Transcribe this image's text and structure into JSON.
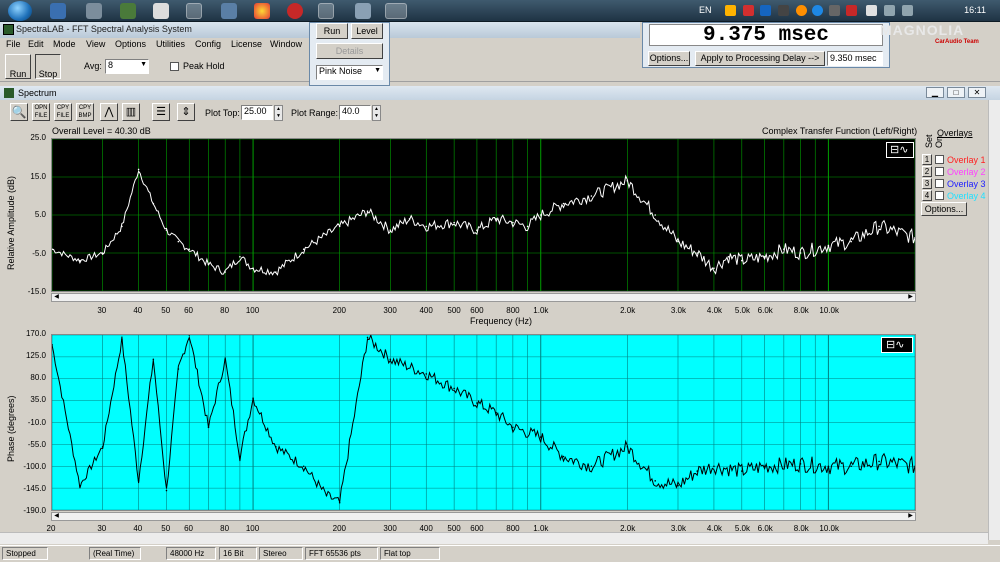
{
  "taskbar": {
    "language": "EN",
    "clock": "16:11",
    "watermark": "MAGNOLIA",
    "watermark_sub": "CarAudio Team"
  },
  "app": {
    "title": "SpectraLAB - FFT Spectral Analysis System",
    "menus": [
      "File",
      "Edit",
      "Mode",
      "View",
      "Options",
      "Utilities",
      "Config",
      "License",
      "Window"
    ],
    "run_label": "Run",
    "stop_label": "Stop",
    "avg_label": "Avg:",
    "avg_value": "8",
    "peak_hold_label": "Peak Hold"
  },
  "generator_popup": {
    "run_label": "Run",
    "level_label": "Level",
    "details_label": "Details",
    "signal_value": "Pink Noise"
  },
  "delay": {
    "value": "9.375 msec",
    "options_label": "Options...",
    "apply_label": "Apply to Processing Delay -->",
    "applied_value": "9.350 msec"
  },
  "spectrum": {
    "window_title": "Spectrum",
    "plot_top_label": "Plot Top:",
    "plot_top_value": "25.00",
    "plot_range_label": "Plot Range:",
    "plot_range_value": "40.0",
    "overall_level": "Overall Level = 40.30 dB",
    "mode_caption": "Complex Transfer Function (Left/Right)",
    "amp_ylabel": "Relative Amplitude (dB)",
    "phase_ylabel": "Phase (degrees)",
    "xlabel": "Frequency (Hz)",
    "amp_yticks": [
      "25.0",
      "15.0",
      "5.0",
      "-5.0",
      "-15.0"
    ],
    "phase_yticks": [
      "170.0",
      "125.0",
      "80.0",
      "35.0",
      "-10.0",
      "-55.0",
      "-100.0",
      "-145.0",
      "-190.0"
    ],
    "x_ticks_top": [
      "30",
      "40",
      "50",
      "60",
      "80",
      "100",
      "200",
      "300",
      "400",
      "500",
      "600",
      "800",
      "1.0k",
      "2.0k",
      "3.0k",
      "4.0k",
      "5.0k",
      "6.0k",
      "8.0k",
      "10.0k"
    ],
    "x_ticks_bottom": [
      "20",
      "30",
      "40",
      "50",
      "60",
      "80",
      "100",
      "200",
      "300",
      "400",
      "500",
      "600",
      "800",
      "1.0k",
      "2.0k",
      "3.0k",
      "4.0k",
      "5.0k",
      "6.0k",
      "8.0k",
      "10.0k"
    ]
  },
  "overlays": {
    "title": "Overlays",
    "set_label": "Set",
    "on_label": "On",
    "items": [
      {
        "num": "1",
        "label": "Overlay 1",
        "color": "#ff2020"
      },
      {
        "num": "2",
        "label": "Overlay 2",
        "color": "#ff40ff"
      },
      {
        "num": "3",
        "label": "Overlay 3",
        "color": "#2020ff"
      },
      {
        "num": "4",
        "label": "Overlay 4",
        "color": "#20e0ff"
      }
    ],
    "options_label": "Options..."
  },
  "status": {
    "state": "Stopped",
    "source": "(Real Time)",
    "rate": "48000 Hz",
    "bits": "16 Bit",
    "channels": "Stereo",
    "fft": "FFT 65536 pts",
    "window": "Flat top"
  },
  "colors": {
    "amp_bg": "#000000",
    "amp_trace": "#ffffff",
    "amp_grid": "#00a000",
    "phase_bg": "#00ffff",
    "phase_trace": "#000000",
    "phase_grid": "#008080"
  },
  "chart_data": [
    {
      "type": "line",
      "title": "",
      "xlabel": "Frequency (Hz)",
      "ylabel": "Relative Amplitude (dB)",
      "x_scale": "log",
      "xlim": [
        20,
        20000
      ],
      "ylim": [
        -15,
        25
      ],
      "grid": true,
      "x": [
        20,
        25,
        30,
        35,
        40,
        45,
        50,
        55,
        60,
        70,
        80,
        90,
        100,
        120,
        150,
        200,
        250,
        300,
        350,
        400,
        500,
        600,
        700,
        800,
        900,
        1000,
        1200,
        1500,
        2000,
        2500,
        3000,
        3500,
        4000,
        4500,
        5000,
        6000,
        7000,
        8000,
        10000,
        12000,
        15000,
        20000
      ],
      "series": [
        {
          "values": [
            -4,
            -7,
            -5,
            2,
            17,
            8,
            1,
            -2,
            -4,
            -8,
            -10,
            -6,
            -9,
            -10,
            -4,
            2,
            6,
            1,
            4,
            2,
            3,
            1,
            4,
            3,
            2,
            5,
            8,
            10,
            14,
            5,
            -2,
            -5,
            -9,
            -6,
            -7,
            -6,
            -4,
            -5,
            -3,
            -2,
            2,
            -1
          ]
        }
      ]
    },
    {
      "type": "line",
      "title": "",
      "xlabel": "Frequency (Hz)",
      "ylabel": "Phase (degrees)",
      "x_scale": "log",
      "xlim": [
        20,
        20000
      ],
      "ylim": [
        -190,
        170
      ],
      "grid": true,
      "x": [
        20,
        25,
        30,
        35,
        40,
        45,
        50,
        55,
        60,
        70,
        80,
        90,
        100,
        120,
        150,
        180,
        200,
        250,
        300,
        400,
        500,
        600,
        700,
        800,
        1000,
        1200,
        1500,
        2000,
        2500,
        3000,
        3500,
        4000,
        5000,
        6000,
        8000,
        10000,
        12000,
        15000,
        20000
      ],
      "series": [
        {
          "values": [
            150,
            -140,
            -60,
            160,
            -130,
            120,
            -150,
            100,
            170,
            -20,
            120,
            -80,
            40,
            -60,
            -100,
            -160,
            -175,
            165,
            120,
            90,
            60,
            30,
            10,
            -20,
            -40,
            -80,
            -100,
            -60,
            -130,
            -140,
            -110,
            -100,
            -110,
            -100,
            -95,
            -100,
            -100,
            -90,
            -100
          ]
        }
      ]
    }
  ]
}
